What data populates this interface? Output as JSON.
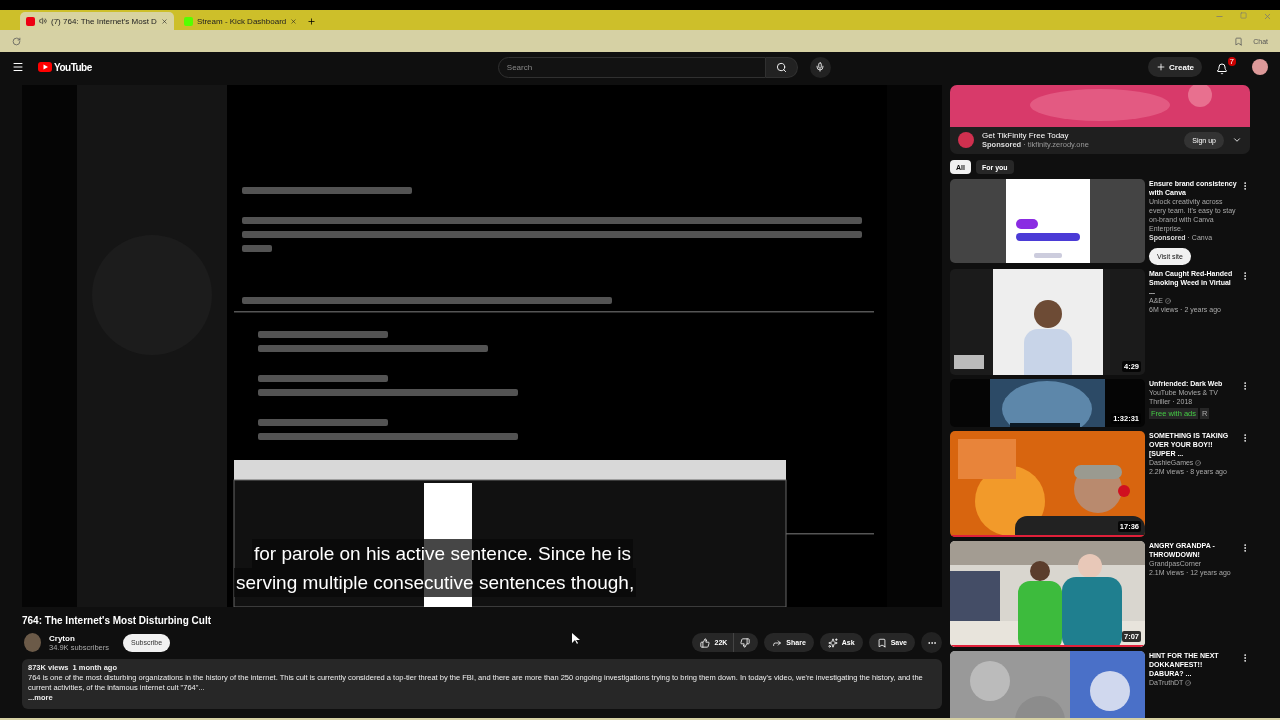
{
  "browser": {
    "tabs": [
      {
        "title": "(7) 764: The Internet's Most D",
        "selected": true,
        "kind": "youtube"
      },
      {
        "title": "Stream - Kick Dashboard",
        "selected": false,
        "kind": "kick"
      }
    ],
    "chat_label": "Chat"
  },
  "masthead": {
    "logo": "YouTube",
    "search_placeholder": "Search",
    "create": "Create",
    "notifications": "7"
  },
  "player": {
    "captions": [
      "for parole on his active sentence. Since he is",
      "serving multiple consecutive sentences though,"
    ]
  },
  "video": {
    "title": "764: The Internet's Most Disturbing Cult",
    "channel": "Cryton",
    "subscribers": "34.9K subscribers",
    "subscribe": "Subscribe",
    "likes": "22K",
    "actions": [
      {
        "kind": "share",
        "label": "Share"
      },
      {
        "kind": "ask",
        "label": "Ask"
      },
      {
        "kind": "save",
        "label": "Save"
      }
    ],
    "views": "873K views",
    "age": "1 month ago",
    "description": "764 is one of the most disturbing organizations in the history of the internet. This cult is currently considered a top-tier threat by the FBI, and there are more than 250 ongoing investigations trying to bring them down. In today's video, we're investigating the history, and the current activities, of the infamous internet cult \"764\"...",
    "more": "...more"
  },
  "ad": {
    "title": "Get TikFinity Free Today",
    "sponsored": "Sponsored",
    "domain": "· tikfinity.zerody.one",
    "cta": "Sign up"
  },
  "chips": [
    {
      "label": "All",
      "selected": true
    },
    {
      "label": "For you",
      "selected": false
    }
  ],
  "recommendations": [
    {
      "kind": "ad",
      "title": "Ensure brand consistency with Canva",
      "description": "Unlock creativity across every team. It's easy to stay on-brand with Canva Enterprise.",
      "sponsored": "Sponsored",
      "source": "· Canva",
      "cta": "Visit site"
    },
    {
      "kind": "video",
      "title": "Man Caught Red-Handed Smoking Weed in Virtual ...",
      "channel": "A&E",
      "verified": true,
      "meta": "6M views · 2 years ago",
      "duration": "4:29"
    },
    {
      "kind": "movie",
      "title": "Unfriended: Dark Web",
      "channel": "YouTube Movies & TV",
      "meta": "Thriller · 2018",
      "badges": [
        "Free with ads",
        "R"
      ],
      "duration": "1:32:31"
    },
    {
      "kind": "video",
      "title": "SOMETHING IS TAKING OVER YOUR BOY!! [SUPER ...",
      "channel": "DashieGames",
      "verified": true,
      "meta": "2.2M views · 8 years ago",
      "duration": "17:36",
      "level": 1
    },
    {
      "kind": "video",
      "title": "ANGRY GRANDPA - THROWDOWN!",
      "channel": "GrandpasCorner",
      "meta": "2.1M views · 12 years ago",
      "duration": "7:07",
      "level": 1
    },
    {
      "kind": "video",
      "title": "HINT FOR THE NEXT DOKKANFEST!! DABURA? ...",
      "channel": "DaTruthDT",
      "verified": true
    }
  ]
}
